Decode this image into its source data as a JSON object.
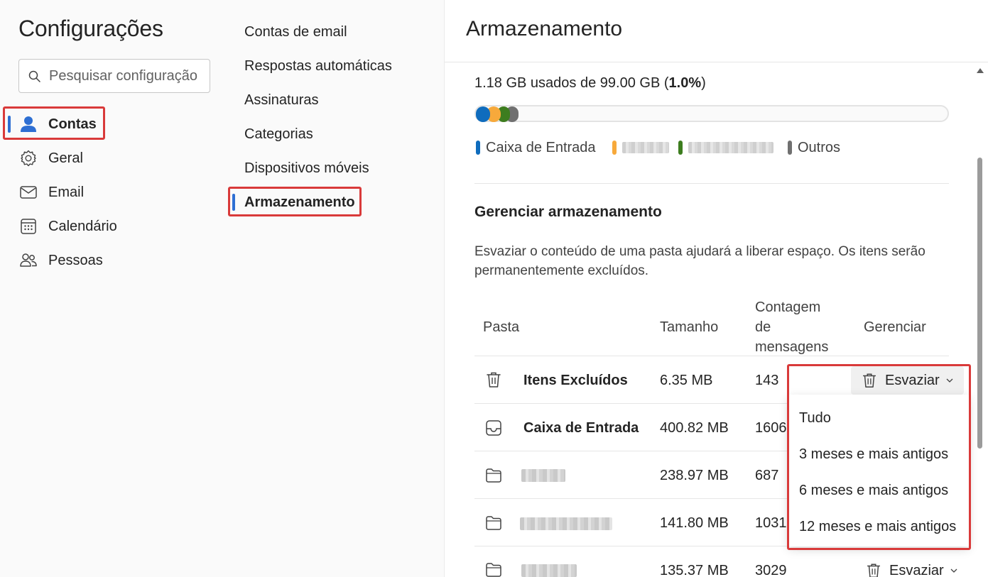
{
  "app": {
    "title": "Configurações"
  },
  "search": {
    "placeholder": "Pesquisar configuração"
  },
  "nav": {
    "items": [
      {
        "label": "Contas",
        "icon": "person-icon",
        "active": true
      },
      {
        "label": "Geral",
        "icon": "gear-icon",
        "active": false
      },
      {
        "label": "Email",
        "icon": "mail-icon",
        "active": false
      },
      {
        "label": "Calendário",
        "icon": "calendar-icon",
        "active": false
      },
      {
        "label": "Pessoas",
        "icon": "people-icon",
        "active": false
      }
    ]
  },
  "subnav": {
    "items": [
      {
        "label": "Contas de email",
        "active": false
      },
      {
        "label": "Respostas automáticas",
        "active": false
      },
      {
        "label": "Assinaturas",
        "active": false
      },
      {
        "label": "Categorias",
        "active": false
      },
      {
        "label": "Dispositivos móveis",
        "active": false
      },
      {
        "label": "Armazenamento",
        "active": true
      }
    ]
  },
  "storage": {
    "title": "Armazenamento",
    "usage_prefix": "1.18 GB usados de 99.00 GB (",
    "usage_percent": "1.0%",
    "usage_suffix": ")",
    "usage_fraction": 0.01,
    "legend": [
      {
        "label": "Caixa de Entrada",
        "color": "#0f6cbd",
        "redacted": false
      },
      {
        "label": "",
        "color": "#f7a93b",
        "redacted": true
      },
      {
        "label": "",
        "color": "#3d7d1f",
        "redacted": true
      },
      {
        "label": "Outros",
        "color": "#707070",
        "redacted": false
      }
    ],
    "manage": {
      "title": "Gerenciar armazenamento",
      "description": "Esvaziar o conteúdo de uma pasta ajudará a liberar espaço. Os itens serão permanentemente excluídos."
    },
    "table": {
      "headers": {
        "folder": "Pasta",
        "size": "Tamanho",
        "count_line1": "Contagem",
        "count_line2": "de",
        "count_line3": "mensagens",
        "manage": "Gerenciar"
      },
      "rows": [
        {
          "name": "Itens Excluídos",
          "icon": "trash-icon",
          "size": "6.35 MB",
          "count": "143",
          "redacted": false
        },
        {
          "name": "Caixa de Entrada",
          "icon": "inbox-icon",
          "size": "400.82 MB",
          "count": "1606",
          "redacted": false
        },
        {
          "name": "",
          "icon": "folder-icon",
          "size": "238.97 MB",
          "count": "687",
          "redacted": true
        },
        {
          "name": "",
          "icon": "folder-icon",
          "size": "141.80 MB",
          "count": "1031",
          "redacted": true
        },
        {
          "name": "",
          "icon": "folder-icon",
          "size": "135.37 MB",
          "count": "3029",
          "redacted": true
        }
      ],
      "empty_label": "Esvaziar"
    },
    "dropdown": {
      "options": [
        "Tudo",
        "3 meses e mais antigos",
        "6 meses e mais antigos",
        "12 meses e mais antigos"
      ]
    }
  },
  "colors": {
    "accent": "#2e6fd3",
    "highlight": "#d93a3a",
    "inbox": "#0f6cbd",
    "orange": "#f7a93b",
    "green": "#3d7d1f",
    "other": "#707070"
  }
}
